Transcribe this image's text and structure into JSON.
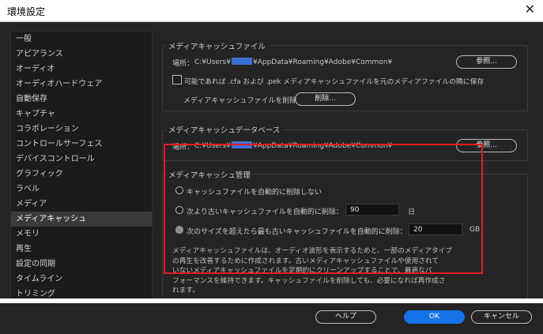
{
  "window": {
    "title": "環境設定",
    "close_glyph": "✕"
  },
  "sidebar": {
    "items": [
      {
        "label": "一般"
      },
      {
        "label": "アピアランス"
      },
      {
        "label": "オーディオ"
      },
      {
        "label": "オーディオハードウェア"
      },
      {
        "label": "自動保存"
      },
      {
        "label": "キャプチャ"
      },
      {
        "label": "コラボレーション"
      },
      {
        "label": "コントロールサーフェス"
      },
      {
        "label": "デバイスコントロール"
      },
      {
        "label": "グラフィック"
      },
      {
        "label": "ラベル"
      },
      {
        "label": "メディア"
      },
      {
        "label": "メディアキャッシュ"
      },
      {
        "label": "メモリ"
      },
      {
        "label": "再生"
      },
      {
        "label": "設定の同期"
      },
      {
        "label": "タイムライン"
      },
      {
        "label": "トリミング"
      }
    ],
    "selected": "メディアキャッシュ"
  },
  "media_cache_files": {
    "group_label": "メディアキャッシュファイル",
    "location_label": "場所：",
    "path_prefix": "C:¥Users¥",
    "path_suffix": "¥AppData¥Roaming¥Adobe¥Common¥",
    "browse_label": "参照...",
    "checkbox_label": "可能であれば .cfa および .pek メディアキャッシュファイルを元のメディアファイルの隣に保存",
    "checkbox_checked": false,
    "delete_label": "メディアキャッシュファイルを削除",
    "delete_button": "削除..."
  },
  "media_cache_db": {
    "group_label": "メディアキャッシュデータベース",
    "location_label": "場所：",
    "path_prefix": "C:¥Users¥",
    "path_suffix": "¥AppData¥Roaming¥Adobe¥Common¥",
    "browse_label": "参照..."
  },
  "media_cache_management": {
    "group_label": "メディアキャッシュ管理",
    "option1": "キャッシュファイルを自動的に削除しない",
    "option2": "次より古いキャッシュファイルを自動的に削除：",
    "option2_value": "90",
    "option2_unit": "日",
    "option3": "次のサイズを超えたら最も古いキャッシュファイルを自動的に削除：",
    "option3_value": "20",
    "option3_unit": "GB",
    "selected_option": "option3",
    "description_lines": [
      "メディアキャッシュファイルは、オーディオ波形を表示するためと、一部のメディアタイプ",
      "の再生を改善するために作成されます。古いメディアキャッシュファイルや使用されて",
      "いないメディアキャッシュファイルを定期的にクリーンアップすることで、最適なパ",
      "フォーマンスを維持できます。キャッシュファイルを削除しても、必要になれば再作成さ",
      "れます。"
    ]
  },
  "footer": {
    "help": "ヘルプ",
    "ok": "OK",
    "cancel": "キャンセル"
  },
  "colors": {
    "highlight_box": "#e51c23",
    "primary_button": "#1473e6",
    "redaction": "#3d6fd6"
  }
}
